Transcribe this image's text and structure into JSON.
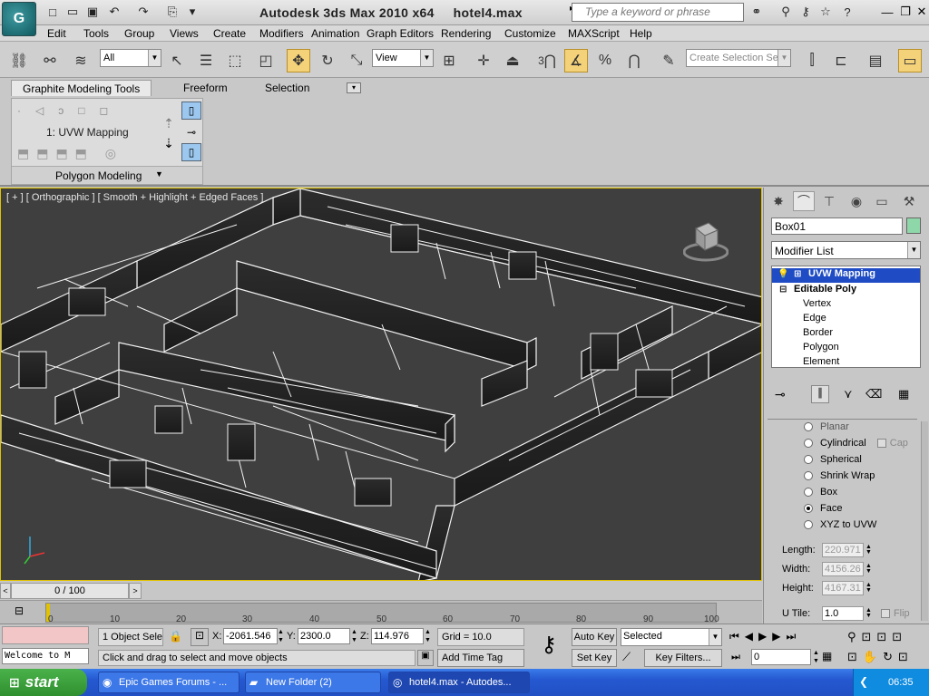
{
  "titlebar": {
    "title": "Autodesk 3ds Max  2010 x64",
    "filename": "hotel4.max",
    "search_placeholder": "Type a keyword or phrase"
  },
  "menu": [
    "Edit",
    "Tools",
    "Group",
    "Views",
    "Create",
    "Modifiers",
    "Animation",
    "Graph Editors",
    "Rendering",
    "Customize",
    "MAXScript",
    "Help"
  ],
  "toolbar": {
    "selection_filter": "All",
    "ref_coord": "View",
    "snap_value": "3",
    "selection_set_placeholder": "Create Selection Se"
  },
  "ribbon": {
    "tabs": [
      "Graphite Modeling Tools",
      "Freeform",
      "Selection"
    ],
    "modifier_label": "1: UVW Mapping",
    "panel_label": "Polygon Modeling"
  },
  "viewport": {
    "label": "[ + ] [ Orthographic ] [ Smooth + Highlight + Edged Faces ]"
  },
  "cmdpanel": {
    "object_name": "Box01",
    "object_color": "#8ed7a8",
    "modifier_list": "Modifier List",
    "stack": [
      {
        "label": "UVW Mapping",
        "selected": true
      },
      {
        "label": "Editable Poly",
        "selected": false
      },
      {
        "label": "Vertex",
        "selected": false
      },
      {
        "label": "Edge",
        "selected": false
      },
      {
        "label": "Border",
        "selected": false
      },
      {
        "label": "Polygon",
        "selected": false
      },
      {
        "label": "Element",
        "selected": false
      }
    ],
    "mapping": {
      "options": [
        "Planar",
        "Cylindrical",
        "Spherical",
        "Shrink Wrap",
        "Box",
        "Face",
        "XYZ to UVW"
      ],
      "selected": "Face",
      "cap_label": "Cap",
      "length_label": "Length:",
      "length": "220.971",
      "width_label": "Width:",
      "width": "4156.26",
      "height_label": "Height:",
      "height": "4167.31",
      "utile_label": "U Tile:",
      "utile": "1.0",
      "flip_label": "Flip"
    }
  },
  "timeline": {
    "frame_display": "0 / 100",
    "ticks": [
      "0",
      "10",
      "20",
      "30",
      "40",
      "50",
      "60",
      "70",
      "80",
      "90",
      "100"
    ]
  },
  "status": {
    "maxscript_text": "Welcome to M",
    "selection_info": "1 Object Sele",
    "x_label": "X:",
    "x": "-2061.546",
    "y_label": "Y:",
    "y": "2300.0",
    "z_label": "Z:",
    "z": "114.976",
    "grid": "Grid = 10.0",
    "prompt": "Click and drag to select and move objects",
    "add_time_tag": "Add Time Tag",
    "auto_key": "Auto Key",
    "set_key": "Set Key",
    "key_mode": "Selected",
    "key_filters": "Key Filters...",
    "current_frame": "0"
  },
  "taskbar": {
    "start": "start",
    "tasks": [
      "Epic Games Forums - ...",
      "New Folder (2)",
      "hotel4.max - Autodes..."
    ],
    "clock": "06:35"
  }
}
